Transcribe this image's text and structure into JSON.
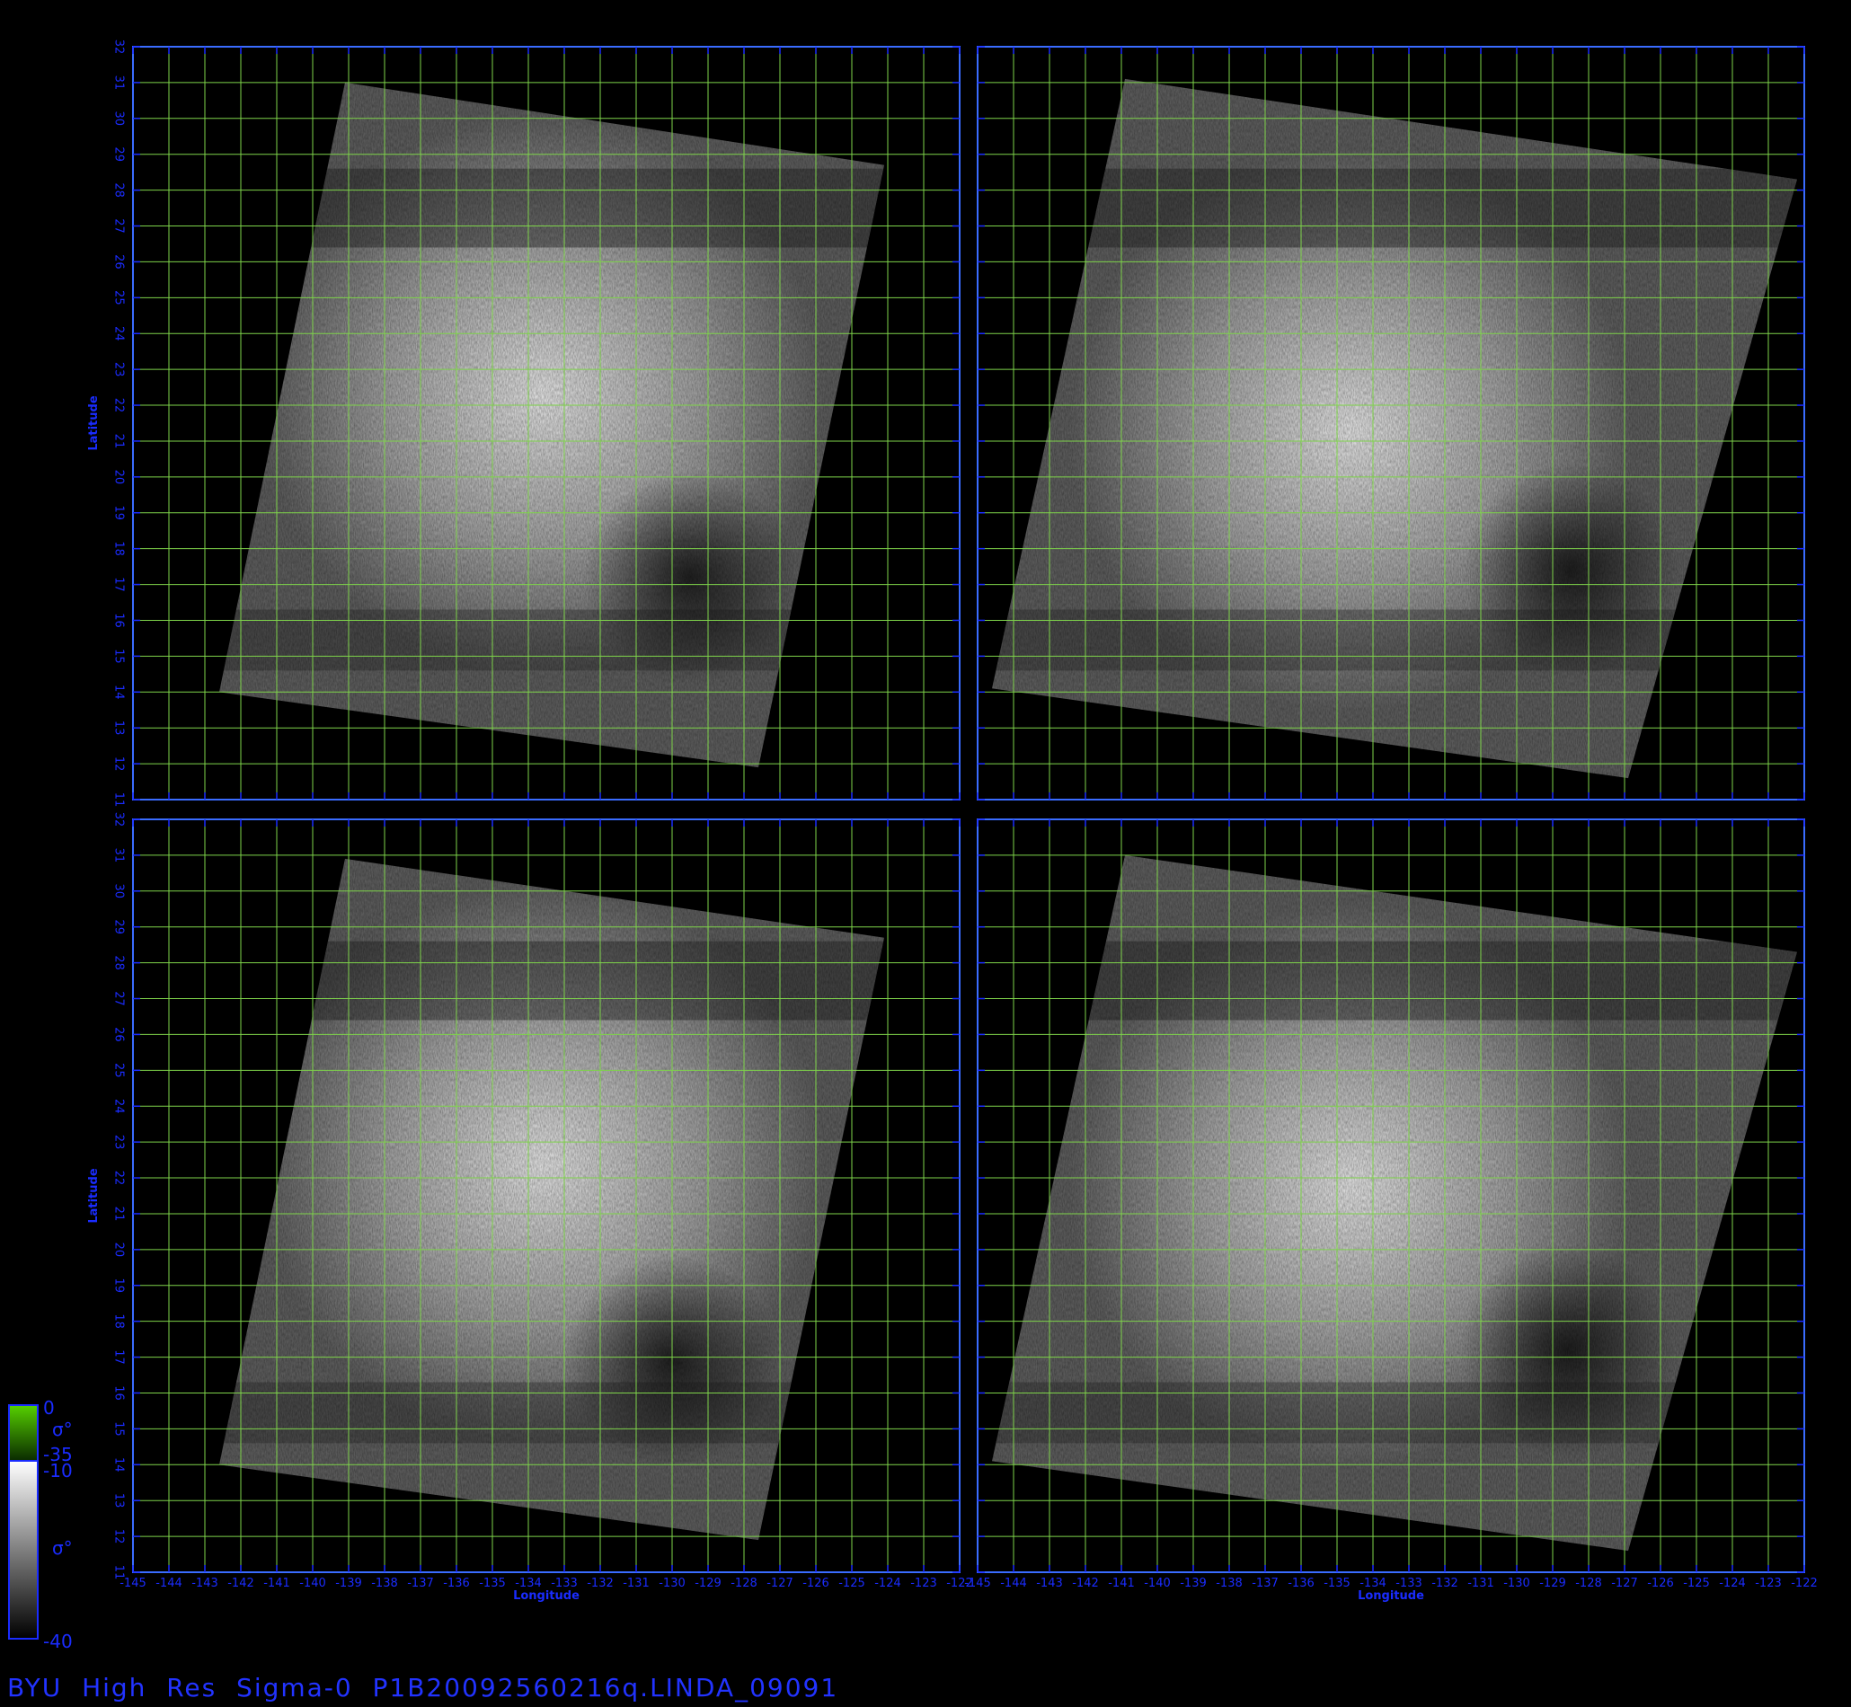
{
  "figure": {
    "title": "BYU  High  Res  Sigma-0  P1B20092560216q.LINDA_09091",
    "background": "#000000",
    "axis_color": "#1a2cff",
    "grid_color": "#7ed34a",
    "frame_color": "#3a6cff"
  },
  "axes": {
    "x_label": "Longitude",
    "y_label": "Latitude",
    "x_ticks": [
      "-145",
      "-144",
      "-143",
      "-142",
      "-141",
      "-140",
      "-139",
      "-138",
      "-137",
      "-136",
      "-135",
      "-134",
      "-133",
      "-132",
      "-131",
      "-130",
      "-129",
      "-128",
      "-127",
      "-126",
      "-125",
      "-124",
      "-123",
      "-122"
    ],
    "y_ticks": [
      "11",
      "12",
      "13",
      "14",
      "15",
      "16",
      "17",
      "18",
      "19",
      "20",
      "21",
      "22",
      "23",
      "24",
      "25",
      "26",
      "27",
      "28",
      "29",
      "30",
      "31",
      "32"
    ],
    "xlim": [
      -145,
      -122
    ],
    "ylim": [
      11,
      32
    ]
  },
  "panels": [
    {
      "id": "top-left",
      "swath": [
        [
          -142.6,
          14.0
        ],
        [
          -139.1,
          31.0
        ],
        [
          -124.1,
          28.7
        ],
        [
          -127.6,
          11.9
        ]
      ],
      "bright": [
        -133.6,
        22.3
      ],
      "dark": [
        -129.5,
        17.2
      ]
    },
    {
      "id": "top-right",
      "swath": [
        [
          -144.6,
          14.1
        ],
        [
          -140.9,
          31.1
        ],
        [
          -122.2,
          28.3
        ],
        [
          -126.9,
          11.6
        ]
      ],
      "bright": [
        -134.6,
        21.3
      ],
      "dark": [
        -128.5,
        17.4
      ]
    },
    {
      "id": "bottom-left",
      "swath": [
        [
          -142.6,
          14.0
        ],
        [
          -139.1,
          30.9
        ],
        [
          -124.1,
          28.7
        ],
        [
          -127.6,
          11.9
        ]
      ],
      "bright": [
        -133.6,
        22.4
      ],
      "dark": [
        -130.0,
        16.9
      ]
    },
    {
      "id": "bottom-right",
      "swath": [
        [
          -144.6,
          14.1
        ],
        [
          -140.9,
          31.0
        ],
        [
          -122.2,
          28.3
        ],
        [
          -126.9,
          11.6
        ]
      ],
      "bright": [
        -134.6,
        21.8
      ],
      "dark": [
        -128.6,
        17.2
      ]
    }
  ],
  "colorbar": {
    "top_label": "0",
    "top_symbol": "σ°",
    "mid_label_a": "-35",
    "mid_label_b": "-10",
    "lower_symbol": "σ°",
    "bottom_label": "-40",
    "upper_color_top": "#56d000",
    "upper_color_bottom": "#0a2a00"
  }
}
